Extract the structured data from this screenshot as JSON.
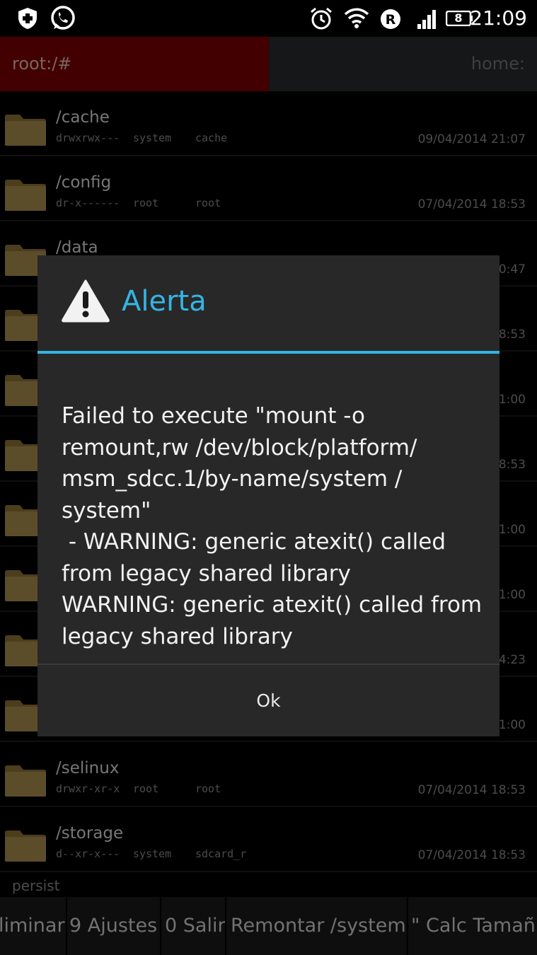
{
  "status_bar": {
    "time": "21:09",
    "battery": "8",
    "icons": [
      "shield-plus-icon",
      "whatsapp-icon",
      "alarm-icon",
      "wifi-icon",
      "roaming-r-icon",
      "signal-icon",
      "battery-icon"
    ]
  },
  "tabs": {
    "root_label": "root:/#",
    "home_label": "home:"
  },
  "files": [
    {
      "name": "/cache",
      "perm": "drwxrwx---",
      "owner": "system",
      "group": "cache",
      "date": "09/04/2014 21:07"
    },
    {
      "name": "/config",
      "perm": "dr-x------",
      "owner": "root",
      "group": "root",
      "date": "07/04/2014 18:53"
    },
    {
      "name": "/data",
      "perm": "",
      "owner": "",
      "group": "",
      "date": "0:47"
    },
    {
      "name": "",
      "perm": "",
      "owner": "",
      "group": "",
      "date": "18:53"
    },
    {
      "name": "",
      "perm": "",
      "owner": "",
      "group": "",
      "date": "1:00"
    },
    {
      "name": "",
      "perm": "",
      "owner": "",
      "group": "",
      "date": "18:53"
    },
    {
      "name": "",
      "perm": "",
      "owner": "",
      "group": "",
      "date": "1:00"
    },
    {
      "name": "",
      "perm": "",
      "owner": "",
      "group": "",
      "date": "1:00"
    },
    {
      "name": "",
      "perm": "",
      "owner": "",
      "group": "",
      "date": "4:23"
    },
    {
      "name": "",
      "perm": "",
      "owner": "",
      "group": "",
      "date": "1:00"
    },
    {
      "name": "/selinux",
      "perm": "drwxr-xr-x",
      "owner": "root",
      "group": "root",
      "date": "07/04/2014 18:53"
    },
    {
      "name": "/storage",
      "perm": "d--xr-x---",
      "owner": "system",
      "group": "sdcard_r",
      "date": "07/04/2014 18:53"
    }
  ],
  "persist_label": "persist",
  "bottom_buttons": [
    "liminar",
    "9 Ajustes",
    "0 Salir",
    "Remontar /system",
    "\" Calc Tamañ"
  ],
  "dialog": {
    "title": "Alerta",
    "message": "Failed to execute \"mount -o remount,rw /dev/block/platform/ msm_sdcc.1/by-name/system / system\"\n - WARNING: generic atexit() called from legacy shared library\nWARNING: generic atexit() called from legacy shared library",
    "ok_label": "Ok"
  },
  "colors": {
    "accent": "#33b5e5",
    "root_tab": "#7a0000",
    "folder": "#a88c4e"
  }
}
